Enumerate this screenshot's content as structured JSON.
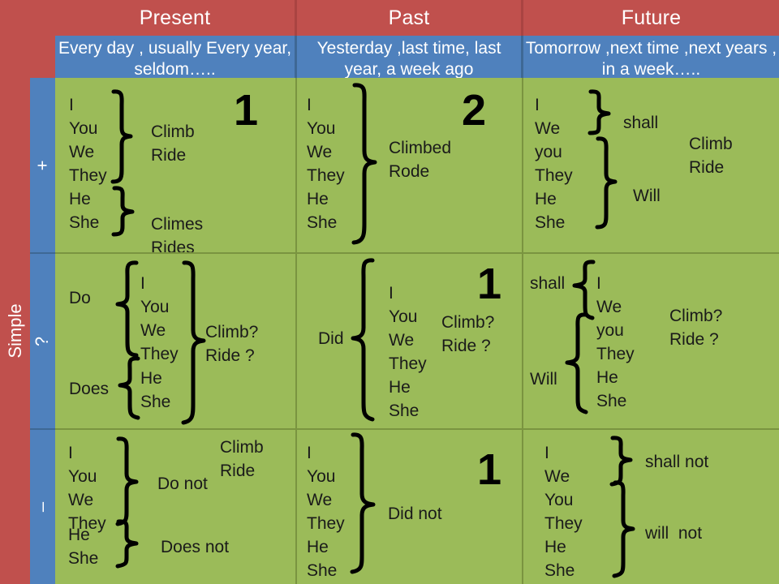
{
  "table": {
    "corner_label": "",
    "row_group_label": "Simple",
    "columns": [
      {
        "id": "present",
        "title": "Present",
        "markers": "Every day , usually\nEvery year, seldom….."
      },
      {
        "id": "past",
        "title": "Past",
        "markers": "Yesterday ,last time, last\nyear, a week ago"
      },
      {
        "id": "future",
        "title": "Future",
        "markers": "Tomorrow ,next time ,next\nyears , in a week….."
      }
    ],
    "rows": [
      {
        "id": "affirmative",
        "symbol": "+"
      },
      {
        "id": "interrogative",
        "symbol": "?"
      },
      {
        "id": "negative",
        "symbol": "–"
      }
    ]
  },
  "cells": {
    "present_plus": {
      "subjects_group1": "I\nYou\nWe\nThey",
      "verbs_group1": "Climb\nRide",
      "subjects_group2": "He\nShe",
      "verbs_group2": "Climes\nRides",
      "number": "1"
    },
    "past_plus": {
      "subjects": "I\nYou\nWe\nThey\nHe\nShe",
      "verbs": "Climbed\nRode",
      "number": "2"
    },
    "future_plus": {
      "subjects_group1": "I\nWe",
      "aux_group1": "shall",
      "subjects_group2": "you\nThey\nHe\nShe",
      "aux_group2": "Will",
      "verbs": "Climb\nRide"
    },
    "present_q": {
      "aux1": "Do",
      "subjects_group1": "I\nYou\nWe\nThey",
      "aux2": "Does",
      "subjects_group2": "He\nShe",
      "verbs": "Climb?\nRide ?"
    },
    "past_q": {
      "aux": "Did",
      "subjects": "I\nYou\nWe\nThey\nHe\nShe",
      "verbs": "Climb?\nRide ?",
      "number": "1"
    },
    "future_q": {
      "aux1": "shall",
      "subjects_group1": "I\nWe",
      "aux2": "Will",
      "subjects_group2": "you\nThey\nHe\nShe",
      "verbs": "Climb?\nRide ?"
    },
    "present_minus": {
      "subjects_group1": "I\nYou\nWe\nThey",
      "aux1": "Do not",
      "subjects_group2": "He\nShe",
      "aux2": "Does not",
      "verbs": "Climb\nRide"
    },
    "past_minus": {
      "subjects": "I\nYou\nWe\nThey\nHe\nShe",
      "aux": "Did not",
      "number": "1"
    },
    "future_minus": {
      "subjects_group1": "I\nWe",
      "aux1": "shall not",
      "subjects_group2": "You\nThey\nHe\nShe",
      "aux2": "will  not"
    }
  },
  "colors": {
    "header_red": "#C0504D",
    "header_blue": "#4F81BD",
    "body_green": "#9BBB59",
    "gridline": "#7A9440",
    "ink": "#000000"
  }
}
